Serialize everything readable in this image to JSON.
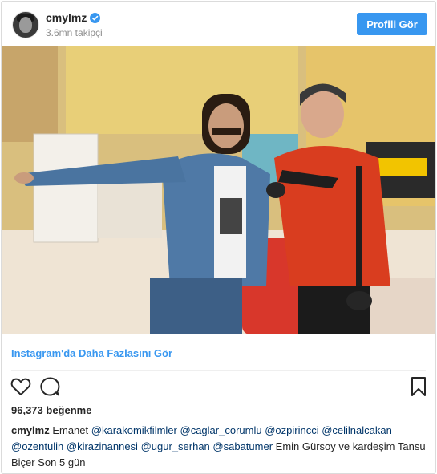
{
  "header": {
    "username": "cmylmz",
    "followers": "3.6mn takipçi",
    "profile_button": "Profili Gör"
  },
  "post": {
    "more_link": "Instagram'da Daha Fazlasını Gör",
    "likes": "96,373 beğenme",
    "caption": {
      "user": "cmylmz",
      "text_before": "Emanet",
      "mentions": [
        "@karakomikfilmler",
        "@caglar_corumlu",
        "@ozpirincci",
        "@celilnalcakan",
        "@ozentulin",
        "@kirazinannesi",
        "@ugur_serhan",
        "@sabatumer"
      ],
      "text_after": "Emin Gürsoy ve kardeşim Tansu Biçer Son 5 gün"
    }
  },
  "colors": {
    "accent": "#3897f0",
    "mention": "#003569",
    "text": "#262626",
    "muted": "#8e8e8e"
  },
  "icons": [
    "verified-badge-icon",
    "heart-icon",
    "comment-icon",
    "bookmark-icon"
  ]
}
